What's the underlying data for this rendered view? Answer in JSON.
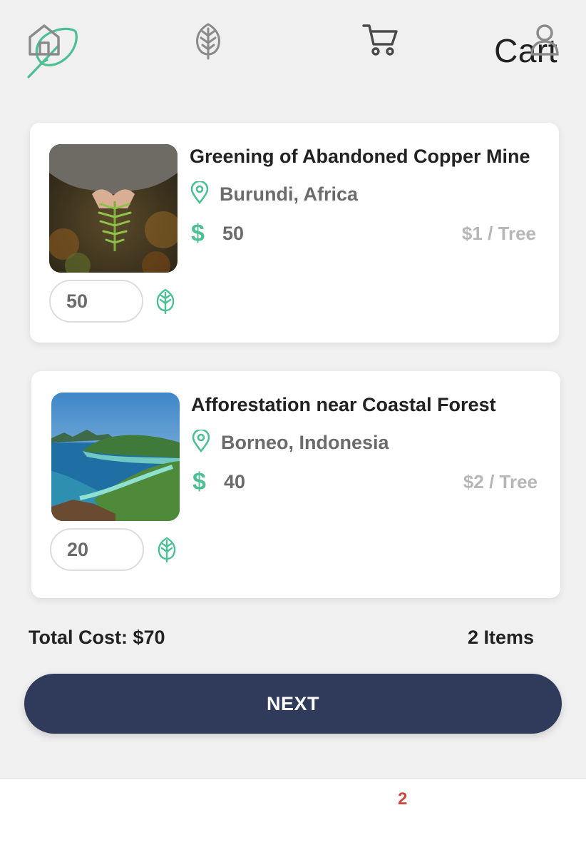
{
  "header": {
    "title": "Cart",
    "logo_icon": "feather-icon"
  },
  "cart_items": [
    {
      "title": "Greening of Abandoned Copper Mine",
      "location": "Burundi, Africa",
      "currency_symbol": "$",
      "amount": "50",
      "rate": "$1 / Tree",
      "quantity": "50"
    },
    {
      "title": "Afforestation near Coastal Forest",
      "location": "Borneo, Indonesia",
      "currency_symbol": "$",
      "amount": "40",
      "rate": "$2 / Tree",
      "quantity": "20"
    }
  ],
  "summary": {
    "total_cost": "Total Cost: $70",
    "item_count": "2 Items"
  },
  "actions": {
    "next_label": "NEXT"
  },
  "tabbar": {
    "items": [
      "home-icon",
      "leaf-icon",
      "cart-icon",
      "user-icon"
    ],
    "cart_badge": "2"
  },
  "colors": {
    "accent": "#4cbf93",
    "primary_button": "#303a5a",
    "badge": "#d0453c"
  }
}
